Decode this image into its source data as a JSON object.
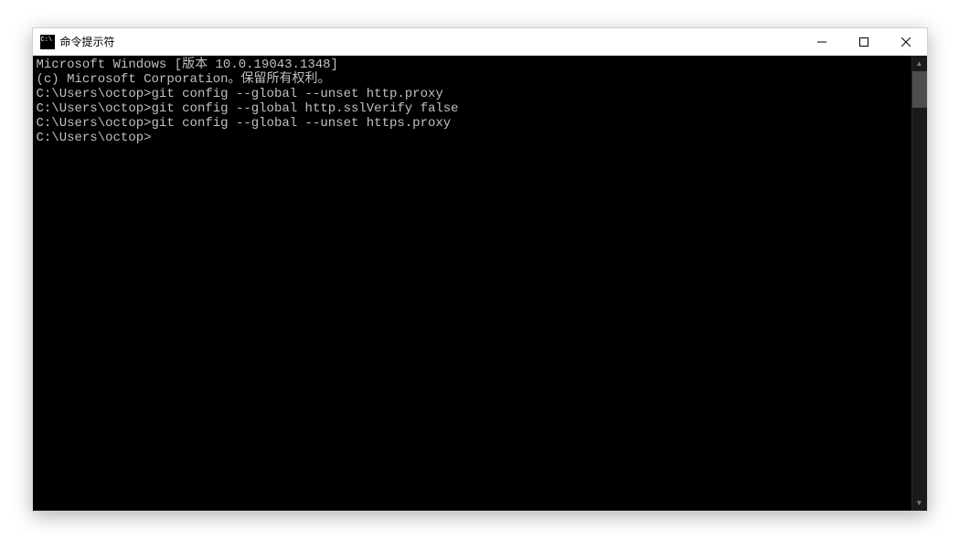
{
  "titlebar": {
    "title": "命令提示符"
  },
  "terminal": {
    "line1": "Microsoft Windows [版本 10.0.19043.1348]",
    "line2": "(c) Microsoft Corporation。保留所有权利。",
    "blank": "",
    "prompt1_path": "C:\\Users\\octop>",
    "prompt1_cmd": "git config --global --unset http.proxy",
    "prompt2_path": "C:\\Users\\octop>",
    "prompt2_cmd": "git config --global http.sslVerify false",
    "prompt3_path": "C:\\Users\\octop>",
    "prompt3_cmd": "git config --global --unset https.proxy",
    "prompt4_path": "C:\\Users\\octop>",
    "prompt4_cmd": ""
  }
}
